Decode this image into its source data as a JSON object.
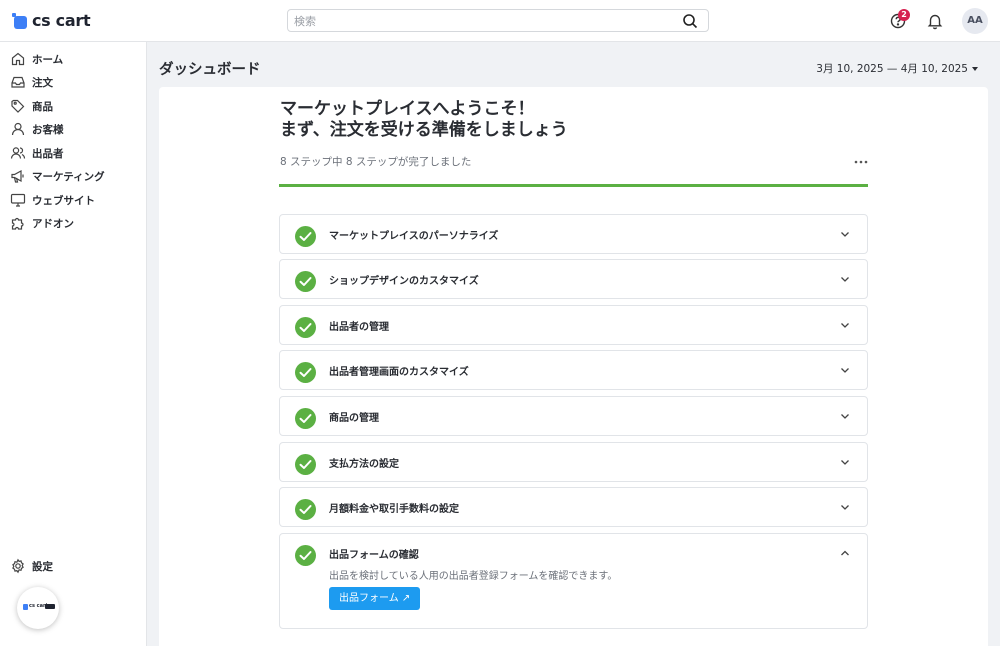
{
  "app": {
    "logo_text": "cs cart",
    "mini_logo_text": "cs cart"
  },
  "search": {
    "placeholder": "検索"
  },
  "topbar": {
    "notification_count": "2",
    "user_initials": "AA",
    "icons": [
      "help-icon",
      "bell-icon"
    ]
  },
  "sidebar": {
    "items": [
      {
        "label": "ホーム",
        "icon": "home-icon"
      },
      {
        "label": "注文",
        "icon": "inbox-icon"
      },
      {
        "label": "商品",
        "icon": "tag-icon"
      },
      {
        "label": "お客様",
        "icon": "user-icon"
      },
      {
        "label": "出品者",
        "icon": "users-icon"
      },
      {
        "label": "マーケティング",
        "icon": "megaphone-icon"
      },
      {
        "label": "ウェブサイト",
        "icon": "monitor-icon"
      },
      {
        "label": "アドオン",
        "icon": "puzzle-icon"
      }
    ],
    "settings": {
      "label": "設定",
      "icon": "gear-icon"
    }
  },
  "header": {
    "title": "ダッシュボード",
    "date_range": "3月 10, 2025 — 4月 10, 2025"
  },
  "main": {
    "welcome_line1": "マーケットプレイスへようこそ！",
    "welcome_line2": "まず、注文を受ける準備をしましょう",
    "progress_text": "8 ステップ中 8 ステップが完了しました",
    "progress_fraction": 1.0,
    "steps": [
      {
        "label": "マーケットプレイスのパーソナライズ",
        "done": true,
        "expanded": false
      },
      {
        "label": "ショップデザインのカスタマイズ",
        "done": true,
        "expanded": false
      },
      {
        "label": "出品者の管理",
        "done": true,
        "expanded": false
      },
      {
        "label": "出品者管理画面のカスタマイズ",
        "done": true,
        "expanded": false
      },
      {
        "label": "商品の管理",
        "done": true,
        "expanded": false
      },
      {
        "label": "支払方法の設定",
        "done": true,
        "expanded": false
      },
      {
        "label": "月額料金や取引手数料の設定",
        "done": true,
        "expanded": false
      },
      {
        "label": "出品フォームの確認",
        "done": true,
        "expanded": true,
        "description": "出品を検討している人用の出品者登録フォームを確認できます。",
        "button_label": "出品フォーム ↗"
      }
    ]
  },
  "colors": {
    "accent_green": "#5bb043",
    "button_blue": "#1d9bf0",
    "badge_red": "#d6204f",
    "logo_blue": "#3d7ff6"
  }
}
